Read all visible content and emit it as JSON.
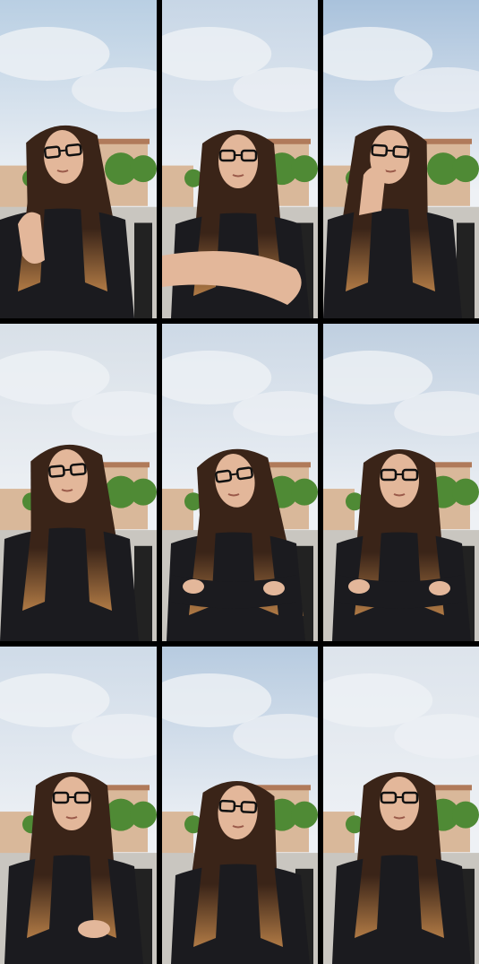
{
  "grid": {
    "rows": 3,
    "columns": 3,
    "separator_color": "#000000"
  },
  "frames": [
    {
      "name": "frame-1",
      "pose": "hand-raised-gesture",
      "glasses": "black",
      "sky": "#b9cfe3"
    },
    {
      "name": "frame-2",
      "pose": "arm-extended-forward",
      "glasses": "black",
      "sky": "#c7d6e6"
    },
    {
      "name": "frame-3",
      "pose": "hand-at-chin",
      "glasses": "black",
      "sky": "#a9c2dc"
    },
    {
      "name": "frame-4",
      "pose": "looking-left",
      "glasses": "black",
      "sky": "#d8e0e8"
    },
    {
      "name": "frame-5",
      "pose": "arms-crossed-profile",
      "glasses": "black",
      "sky": "#cdd9e6"
    },
    {
      "name": "frame-6",
      "pose": "arms-crossed-front",
      "glasses": "black",
      "sky": "#bfcfe0"
    },
    {
      "name": "frame-7",
      "pose": "talking",
      "glasses": "black",
      "sky": "#cfdbe8"
    },
    {
      "name": "frame-8",
      "pose": "head-tilted",
      "glasses": "black",
      "sky": "#b7cbe0"
    },
    {
      "name": "frame-9",
      "pose": "smiling-front",
      "glasses": "black",
      "sky": "#dde4ec"
    }
  ],
  "colors": {
    "cloud": "#eef1f5",
    "building": "#d9b89a",
    "building_roof": "#b07a5a",
    "tree": "#4f8a35",
    "ground": "#c9c6c0",
    "hair_dark": "#3a2418",
    "hair_light": "#b07a45",
    "skin": "#e3b79a",
    "sweater": "#1b1b1f",
    "chair": "#222222"
  }
}
